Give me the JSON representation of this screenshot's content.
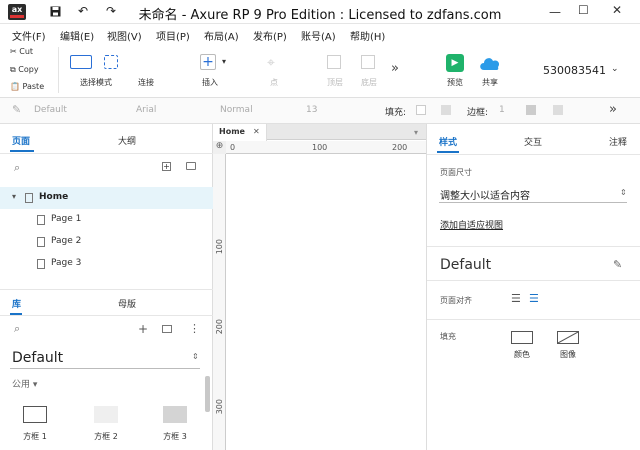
{
  "window": {
    "title": "未命名 - Axure RP 9 Pro Edition : Licensed to zdfans.com",
    "logo_text": "ax"
  },
  "menu": [
    "文件(F)",
    "编辑(E)",
    "视图(V)",
    "项目(P)",
    "布局(A)",
    "发布(P)",
    "账号(A)",
    "帮助(H)"
  ],
  "clipboard": {
    "cut": "Cut",
    "copy": "Copy",
    "paste": "Paste"
  },
  "toolbar": {
    "select_mode": "选择模式",
    "connect": "连接",
    "insert": "插入",
    "point": "点",
    "top": "顶层",
    "bottom": "底层",
    "preview": "预览",
    "share": "共享",
    "account": "530083541"
  },
  "format": {
    "style": "Default",
    "font": "Arial",
    "weight": "Normal",
    "size": "13",
    "fill_label": "填充:",
    "border_label": "边框:",
    "border_value": "1"
  },
  "left": {
    "tab_pages": "页面",
    "tab_outline": "大纲",
    "pages": [
      {
        "name": "Home",
        "level": 0
      },
      {
        "name": "Page 1",
        "level": 1
      },
      {
        "name": "Page 2",
        "level": 1
      },
      {
        "name": "Page 3",
        "level": 1
      }
    ],
    "tab_library": "库",
    "tab_masters": "母版",
    "library_name": "Default",
    "section": "公用",
    "shapes": [
      "方框 1",
      "方框 2",
      "方框 3"
    ]
  },
  "canvas": {
    "tab": "Home",
    "ruler_h": [
      "0",
      "100",
      "200"
    ],
    "ruler_v": [
      "100",
      "200",
      "300"
    ]
  },
  "right": {
    "tab_style": "样式",
    "tab_interact": "交互",
    "tab_notes": "注释",
    "page_size_label": "页面尺寸",
    "page_size_value": "调整大小以适合内容",
    "adaptive_link": "添加自适应视图",
    "style_name": "Default",
    "align_label": "页面对齐",
    "fill_label": "填充",
    "fill_color": "颜色",
    "fill_image": "图像"
  },
  "colors": {
    "accent": "#1a73c8",
    "preview": "#1fb36b",
    "share": "#2b9be8"
  }
}
